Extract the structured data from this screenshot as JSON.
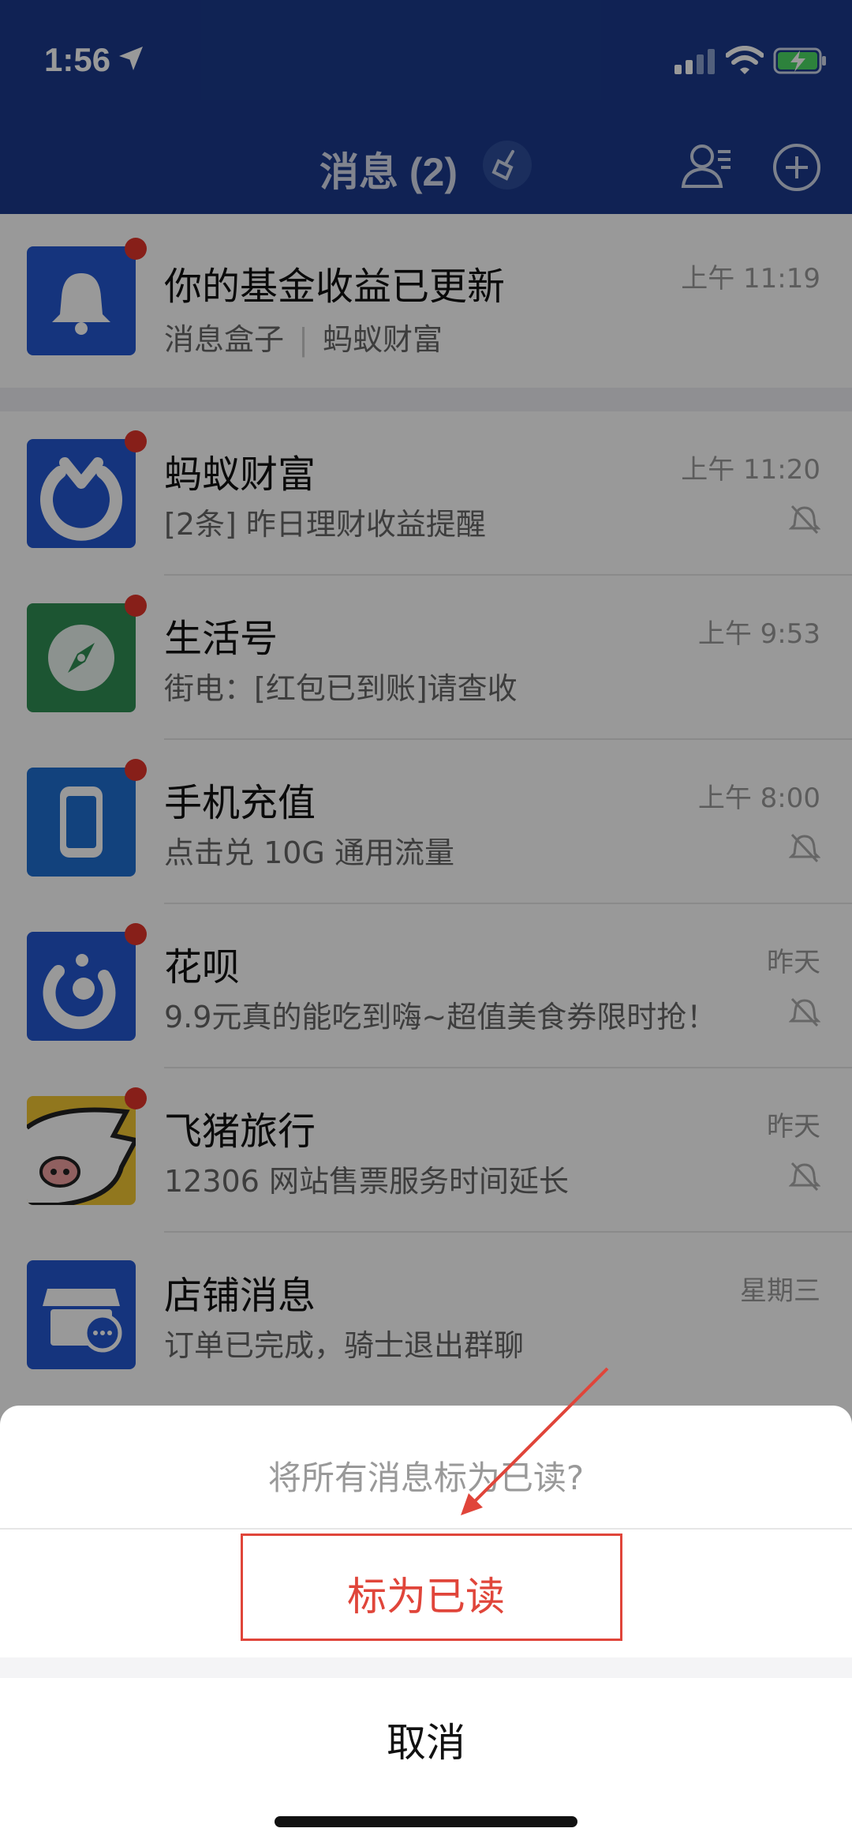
{
  "status_bar": {
    "time": "1:56"
  },
  "nav": {
    "title": "消息 (2)"
  },
  "messages": [
    {
      "name": "你的基金收益已更新",
      "subtitle_a": "消息盒子",
      "subtitle_b": "蚂蚁财富",
      "time": "上午 11:19",
      "muted": false,
      "unread": true
    },
    {
      "name": "蚂蚁财富",
      "subtitle": "[2条] 昨日理财收益提醒",
      "time": "上午 11:20",
      "muted": true,
      "unread": true
    },
    {
      "name": "生活号",
      "subtitle": "街电：[红包已到账]请查收",
      "time": "上午 9:53",
      "muted": false,
      "unread": true
    },
    {
      "name": "手机充值",
      "subtitle": "点击兑 10G 通用流量",
      "time": "上午 8:00",
      "muted": true,
      "unread": true
    },
    {
      "name": "花呗",
      "subtitle": "9.9元真的能吃到嗨~超值美食券限时抢！",
      "time": "昨天",
      "muted": true,
      "unread": true
    },
    {
      "name": "飞猪旅行",
      "subtitle": "12306 网站售票服务时间延长",
      "time": "昨天",
      "muted": true,
      "unread": true
    },
    {
      "name": "店铺消息",
      "subtitle": "订单已完成，骑士退出群聊",
      "time": "星期三",
      "muted": false,
      "unread": false
    }
  ],
  "action_sheet": {
    "prompt": "将所有消息标为已读?",
    "confirm_label": "标为已读",
    "cancel_label": "取消"
  },
  "colors": {
    "nav_background": "#1b3a8c",
    "unread_dot": "#e2352b",
    "confirm_text": "#e0453a"
  }
}
